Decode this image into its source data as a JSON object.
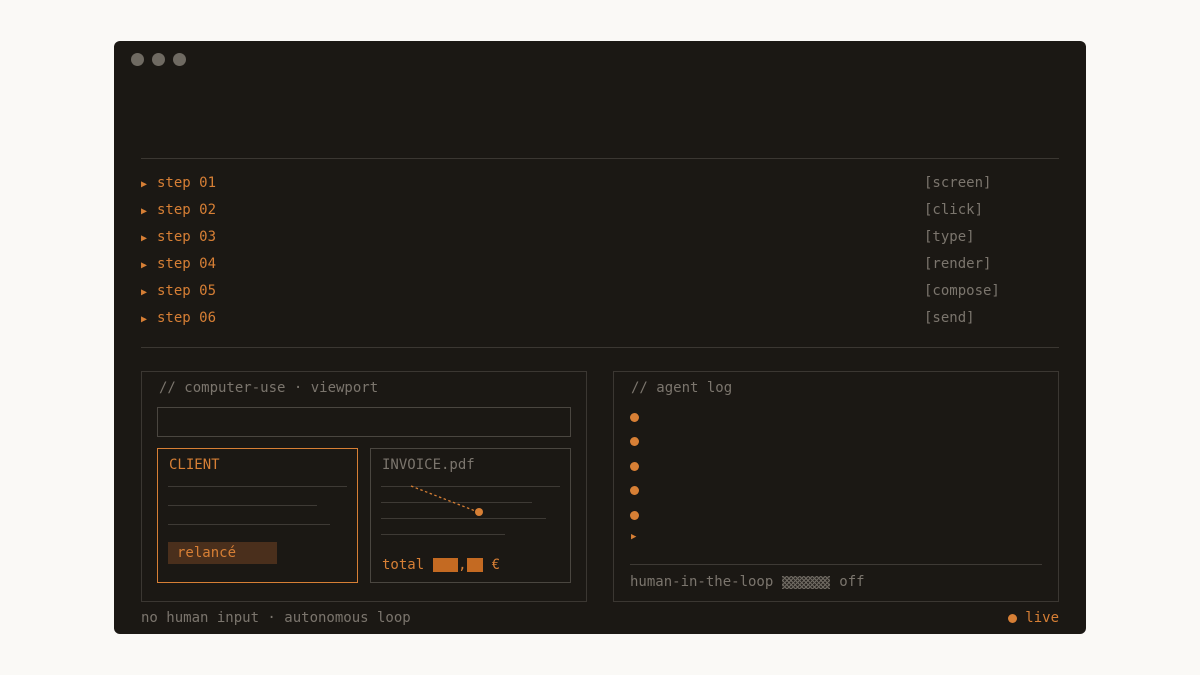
{
  "steps": [
    {
      "label": "step 01",
      "tag": "[screen]"
    },
    {
      "label": "step 02",
      "tag": "[click]"
    },
    {
      "label": "step 03",
      "tag": "[type]"
    },
    {
      "label": "step 04",
      "tag": "[render]"
    },
    {
      "label": "step 05",
      "tag": "[compose]"
    },
    {
      "label": "step 06",
      "tag": "[send]"
    }
  ],
  "viewport": {
    "title": "// computer-use · viewport",
    "client_title": "CLIENT",
    "relance_label": "relancé",
    "invoice_title": "INVOICE.pdf",
    "total_label": "total",
    "total_sep": ",",
    "currency": "€"
  },
  "log": {
    "title": "// agent log",
    "hitl_label": "human-in-the-loop",
    "hitl_state": "off"
  },
  "footer": {
    "left": "no human input · autonomous loop",
    "status": "live"
  },
  "colors": {
    "accent": "#d77f35",
    "background": "#1b1814",
    "muted": "#7b756d"
  }
}
